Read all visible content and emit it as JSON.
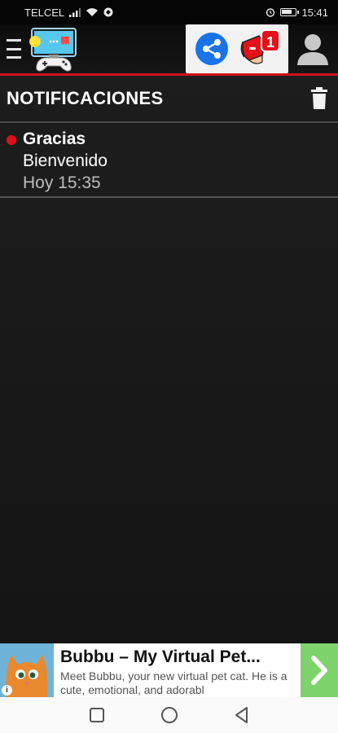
{
  "status_bar": {
    "carrier": "TELCEL",
    "time": "15:41"
  },
  "header": {
    "notification_badge": "1"
  },
  "section": {
    "title": "NOTIFICACIONES"
  },
  "notifications": [
    {
      "title": "Gracias",
      "body": "Bienvenido",
      "time": "Hoy 15:35",
      "unread": true
    }
  ],
  "ad": {
    "title": "Bubbu – My Virtual Pet...",
    "description": "Meet Bubbu, your new virtual pet cat. He is a cute, emotional, and adorabl",
    "info_label": "i"
  },
  "colors": {
    "accent_red": "#d0121b",
    "background": "#1a1a1a",
    "ad_cta": "#7ed36a"
  },
  "icons": {
    "menu": "hamburger-icon",
    "logo": "game-controller-logo",
    "share": "share-icon",
    "notifications": "horn-icon",
    "profile": "user-icon",
    "delete": "trash-icon"
  }
}
